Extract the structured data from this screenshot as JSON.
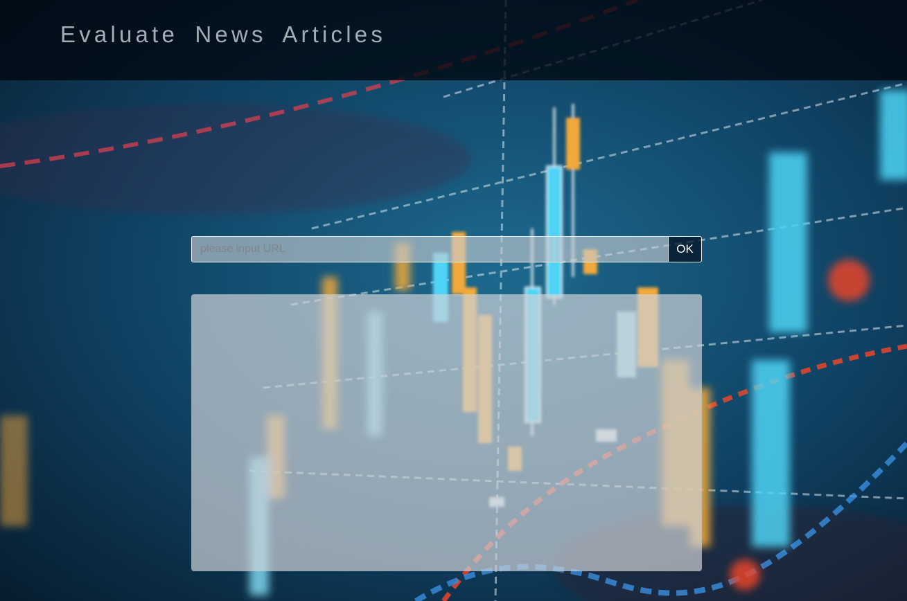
{
  "header": {
    "title": "Evaluate News Articles"
  },
  "search": {
    "placeholder": "please input URL",
    "value": "",
    "submit_label": "OK"
  },
  "result": {
    "text": ""
  },
  "background": {
    "description_icon": "financial-candlestick-chart-background",
    "accent_orange": "#f2a93b",
    "accent_cyan": "#4fd4f5",
    "accent_red": "#e8452a",
    "base_blue": "#0b3a5a"
  }
}
